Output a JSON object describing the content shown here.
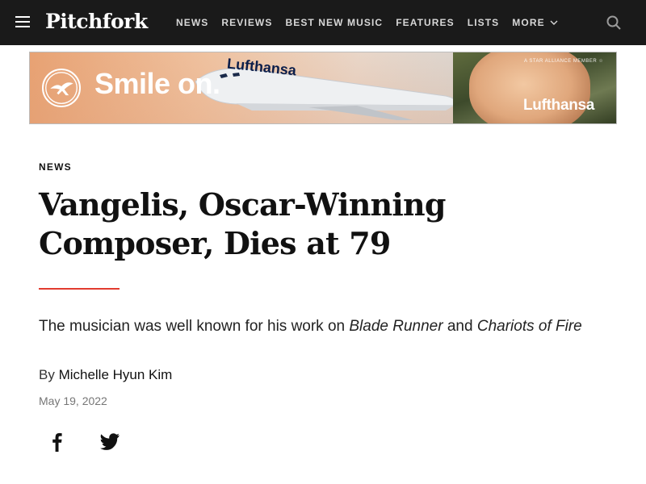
{
  "header": {
    "logo_text": "Pitchfork",
    "nav": [
      {
        "label": "NEWS"
      },
      {
        "label": "REVIEWS"
      },
      {
        "label": "BEST NEW MUSIC"
      },
      {
        "label": "FEATURES"
      },
      {
        "label": "LISTS"
      }
    ],
    "more_label": "MORE",
    "icons": {
      "menu": "menu-icon",
      "search": "search-icon",
      "more": "chevron-down-icon"
    }
  },
  "ad": {
    "headline": "Smile on.",
    "fuselage_text": "Lufthansa",
    "brand": "Lufthansa",
    "alliance_text": "A STAR ALLIANCE MEMBER ☆"
  },
  "article": {
    "category": "NEWS",
    "headline": "Vangelis, Oscar-Winning Composer, Dies at 79",
    "dek_prefix": "The musician was well known for his work on ",
    "dek_title_1": "Blade Runner",
    "dek_middle": " and ",
    "dek_title_2": "Chariots of Fire",
    "byline_prefix": "By ",
    "author": "Michelle Hyun Kim",
    "date": "May 19, 2022",
    "accent_color": "#e23b2f"
  },
  "share": {
    "icons": [
      "facebook-icon",
      "twitter-icon"
    ]
  }
}
